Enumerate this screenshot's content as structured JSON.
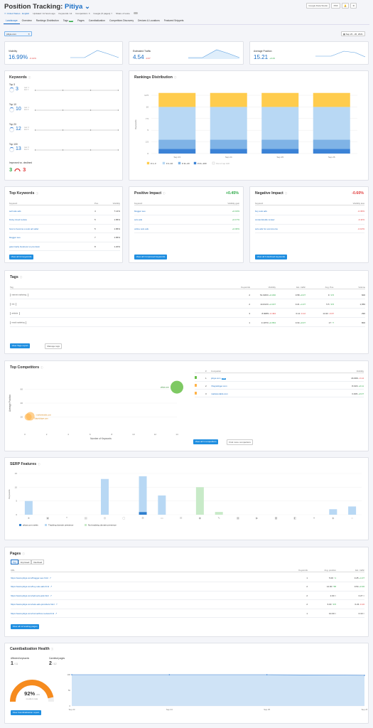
{
  "header": {
    "title": "Position Tracking:",
    "project": "Pitiya",
    "location": "United States · English",
    "updated": "Updated: 11 hours ago",
    "keywords_count": "Keywords: 14",
    "competitors_count": "Competitors: 3",
    "engine": "Google (5 pages)",
    "sov_label": "Share of voice",
    "gds_button": "Google Data Studio",
    "pdf_button": "PDF"
  },
  "tabs": [
    {
      "label": "Landscape"
    },
    {
      "label": "Overview"
    },
    {
      "label": "Rankings Distribution"
    },
    {
      "label": "Tags",
      "badge": "new"
    },
    {
      "label": "Pages"
    },
    {
      "label": "Cannibalization"
    },
    {
      "label": "Competitors Discovery"
    },
    {
      "label": "Devices & Locations"
    },
    {
      "label": "Featured Snippets"
    }
  ],
  "domain_chip": "pitiya.com",
  "date_range": "Sep 23 - 26, 2021",
  "summary": [
    {
      "label": "Visibility",
      "value": "16.99%",
      "change": "-0.14%",
      "dir": "down"
    },
    {
      "label": "Estimated Traffic",
      "value": "4.54",
      "change": "-0.07",
      "dir": "down"
    },
    {
      "label": "Average Position",
      "value": "15.21",
      "change": "+3.43",
      "dir": "up"
    }
  ],
  "keywords": {
    "title": "Keywords",
    "groups": [
      {
        "label": "Top 3",
        "value": "3",
        "new": "new: 1",
        "lost": "lost: 1"
      },
      {
        "label": "Top 10",
        "value": "10",
        "new": "new: 1",
        "lost": "lost: 0"
      },
      {
        "label": "Top 20",
        "value": "12",
        "new": "new: 0",
        "lost": "lost: 0"
      },
      {
        "label": "Top 100",
        "value": "13",
        "new": "new: 0",
        "lost": "lost: 0"
      }
    ],
    "improved_label": "Improved vs. declined",
    "improved": "3",
    "declined": "3"
  },
  "rankings": {
    "title": "Rankings Distribution",
    "ylabel": "Keywords",
    "legend": [
      "# 1–3",
      "# 4–10",
      "# 11–20",
      "# 21–100",
      "Out of top 100"
    ]
  },
  "chart_data": [
    {
      "type": "bar",
      "id": "rankings_distribution",
      "stacked": true,
      "categories": [
        "Sep 23",
        "Sep 24",
        "Sep 25",
        "Sep 26"
      ],
      "series": [
        {
          "name": "# 1–3",
          "color": "#ffcc4d",
          "values": [
            3,
            3,
            3,
            3
          ]
        },
        {
          "name": "# 4–10",
          "color": "#b8d8f4",
          "values": [
            7,
            7,
            7,
            7
          ]
        },
        {
          "name": "# 11–20",
          "color": "#7fb3e6",
          "values": [
            2,
            2,
            2,
            2
          ]
        },
        {
          "name": "# 21–100",
          "color": "#3b82d6",
          "values": [
            1,
            1,
            1,
            1
          ]
        }
      ],
      "ylim": [
        0,
        12.5
      ],
      "yticks": [
        0,
        2.5,
        5,
        7.5,
        10,
        12.5
      ],
      "ylabel": "Keywords"
    },
    {
      "type": "scatter",
      "id": "top_competitors",
      "x": [
        14,
        0.5,
        0.3
      ],
      "y": [
        63,
        21,
        20
      ],
      "labels": [
        "pitiya.com",
        "marketeralds.com",
        "7dayslobger.com"
      ],
      "colors": [
        "#67bf48",
        "#ffb347",
        "#ffb347"
      ],
      "xlim": [
        0,
        14
      ],
      "ylim": [
        0,
        80
      ],
      "xticks": [
        0,
        2,
        4,
        6,
        8,
        10,
        12,
        14
      ],
      "yticks": [
        20,
        40,
        60
      ],
      "xlabel": "Number of Keywords",
      "ylabel": "Average Position"
    },
    {
      "type": "bar",
      "id": "serp_features",
      "categories": [
        "f1",
        "f2",
        "f3",
        "f4",
        "f5",
        "f6",
        "f7",
        "f8",
        "f9",
        "f10",
        "f11",
        "f12",
        "f13",
        "f14",
        "f15",
        "f16",
        "f17",
        "f18"
      ],
      "series": [
        {
          "name": "pitiya.com ranks",
          "color": "#2f7fce",
          "values": [
            0,
            0,
            0,
            0,
            0,
            0,
            1,
            0,
            0,
            0,
            0,
            0,
            0,
            0,
            0,
            0,
            0,
            0
          ]
        },
        {
          "name": "Tracking domain presence",
          "color": "#b8d8f4",
          "values": [
            5,
            0,
            0,
            0,
            13,
            0,
            13,
            7,
            0,
            0,
            0,
            0,
            0,
            0,
            0,
            0,
            2,
            3
          ]
        },
        {
          "name": "Not tracking domain presence",
          "color": "#c8eac8",
          "values": [
            0,
            0,
            0,
            0,
            0,
            0,
            0,
            0,
            0,
            10,
            1,
            0,
            0,
            0,
            0,
            0,
            0,
            0
          ]
        }
      ],
      "ylim": [
        0,
        15
      ],
      "yticks": [
        0,
        5,
        10,
        15
      ],
      "ylabel": "Keywords"
    },
    {
      "type": "line",
      "id": "cannibalization",
      "x": [
        "Sep 23",
        "Sep 24",
        "Sep 25",
        "Sep 26"
      ],
      "values": [
        100,
        100,
        100,
        98
      ],
      "ylim": [
        0,
        100
      ],
      "yticks": [
        0,
        50,
        100
      ]
    }
  ],
  "top_keywords": {
    "title": "Top Keywords",
    "headers": [
      "Keyword",
      "Pos.",
      "Visibility"
    ],
    "rows": [
      [
        "sell solo ads",
        "4",
        "7.14%"
      ],
      [
        "bruky cloud review",
        "5",
        "1.86%"
      ],
      [
        "how to become a solo ad seller",
        "5",
        "1.86%"
      ],
      [
        "blogger seo",
        "7",
        "1.86%"
      ],
      [
        "grammarly business vs premium",
        "8",
        "1.20%"
      ]
    ],
    "button": "View all 14 keywords"
  },
  "positive": {
    "title": "Positive Impact",
    "value": "+0.45%",
    "headers": [
      "Keyword",
      "Visibility gain"
    ],
    "rows": [
      [
        "blogger seo",
        "+0.19%"
      ],
      [
        "solo ads",
        "+0.17%"
      ],
      [
        "online solo ads",
        "+0.03%"
      ]
    ],
    "button": "View all 3 improved keywords"
  },
  "negative": {
    "title": "Negative Impact",
    "value": "-0.60%",
    "headers": [
      "Keyword",
      "Visibility loss"
    ],
    "rows": [
      [
        "buy solo ads",
        "-0.39%"
      ],
      [
        "contentstudio review",
        "-0.11%"
      ],
      [
        "solo ads for ecommerce",
        "-0.10%"
      ]
    ],
    "button": "View all 3 declined keywords"
  },
  "tags": {
    "title": "Tags",
    "headers": [
      "Tag",
      "Keywords",
      "Visibility",
      "Est. traffic",
      "Avg. Pos.",
      "Volume"
    ],
    "rows": [
      [
        "internet marketing",
        "2",
        "51.933%",
        "+0.182",
        "0.58",
        "+0.07",
        "9",
        "3.5",
        "600"
      ],
      [
        "seo",
        "2",
        "14.011%",
        "+2.167",
        "3.21",
        "+1.07",
        "5.5",
        "0.5",
        "1,650"
      ],
      [
        "website",
        "3",
        "8.908%",
        "-0.494",
        "0.12",
        "-0.12",
        "14.33",
        "3.67",
        "290"
      ],
      [
        "email marketing",
        "1",
        "3.107%",
        "+0.654",
        "0.34",
        "+0.07",
        "17",
        "7",
        "800"
      ]
    ],
    "button": "View Tags report",
    "button2": "Manage tags"
  },
  "competitors": {
    "title": "Top Competitors",
    "xlabel": "Number of Keywords",
    "ylabel": "Average Position",
    "headers": [
      "#",
      "Competitor",
      "Visibility"
    ],
    "rows": [
      {
        "n": "1",
        "name": "pitiya.com",
        "tag": "You",
        "vis": "16.99%",
        "chg": "-0.14",
        "color": "#67bf48"
      },
      {
        "n": "2",
        "name": "7dayslobger.com",
        "vis": "8.01%",
        "chg": "+0.11",
        "color": "#ffb347"
      },
      {
        "n": "3",
        "name": "marketeralds.com",
        "vis": "3.19%",
        "chg": "+0.07",
        "color": "#ffb347"
      }
    ],
    "button": "View all 3 competitors",
    "button2": "Find more competitors",
    "bubbles": [
      "pitiya.com",
      "marketeralds.com",
      "7dayslobger.com"
    ]
  },
  "serp": {
    "title": "SERP Features",
    "ylabel": "Keywords",
    "legend": [
      "pitiya.com ranks",
      "Tracking domain presence",
      "Not tracking domain presence"
    ],
    "icons": [
      "★",
      "▣",
      "❝",
      "▤",
      "◎",
      "▢",
      "⚙",
      "▭",
      "☰",
      "◉",
      "✎",
      "▦",
      "▶",
      "▩",
      "◧",
      "✦",
      "◈",
      "⌂"
    ]
  },
  "pages": {
    "title": "Pages",
    "filters": [
      "Top",
      "Improved",
      "Declined"
    ],
    "headers": [
      "URL",
      "Keywords",
      "Avg. position",
      "Est. traffic"
    ],
    "rows": [
      [
        "https://www.pitiya.com/blogger-seo.html",
        "1",
        "5.00",
        "1",
        "3.25",
        "+1.07"
      ],
      [
        "https://www.pitiya.com/buy-solo-ads.html",
        "2",
        "12.00",
        "58",
        "0.54",
        "+0.36"
      ],
      [
        "https://www.pitiya.com/sell-solo-ads.html",
        "2",
        "2.00",
        "0",
        "0.27",
        "0"
      ],
      [
        "https://www.pitiya.com/solo-ads-providers.html",
        "2",
        "6.00",
        "0.5",
        "0.23",
        "-0.16"
      ],
      [
        "https://www.pitiya.com/convertbox-review.html",
        "1",
        "10.00",
        "0",
        "0.19",
        "0"
      ]
    ],
    "button": "View all 12 landing pages"
  },
  "cannibal": {
    "title": "Cannibalization Health",
    "affected_label": "Affected keywords",
    "affected": "1",
    "affected_of": "/ 11",
    "pages_label": "Cannibal pages",
    "pages": "2",
    "pages_of": "/ 12",
    "score": "92%",
    "score_chg": "+0%",
    "rate": "medium rate",
    "button": "View Cannibalization report",
    "xticks": [
      "Sep 23",
      "Sep 24",
      "Sep 25",
      "Sep 26"
    ],
    "yticks": [
      "100",
      "50",
      "0"
    ]
  }
}
